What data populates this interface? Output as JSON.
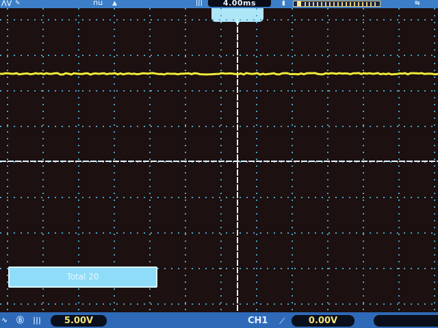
{
  "top_bar": {
    "timebase": "4.00ms",
    "trigger_mode_icon": "run-icon",
    "memory_icon": "memory-depth-icon"
  },
  "trace": {
    "color": "#f0ec3a",
    "channel": "CH1"
  },
  "overlay": {
    "message": "Total  20"
  },
  "bottom_bar": {
    "coupling_label": "AC",
    "volts_per_div": "5.00V",
    "channel_label": "CH1",
    "trigger_level": "0.00V"
  },
  "colors": {
    "background": "#1c1010",
    "grid_dots": "#4aa8c8",
    "axes": "#e8f4ff",
    "trace": "#f0ec3a",
    "bar": "#3c7fc8",
    "readout_text": "#f2e27a"
  }
}
